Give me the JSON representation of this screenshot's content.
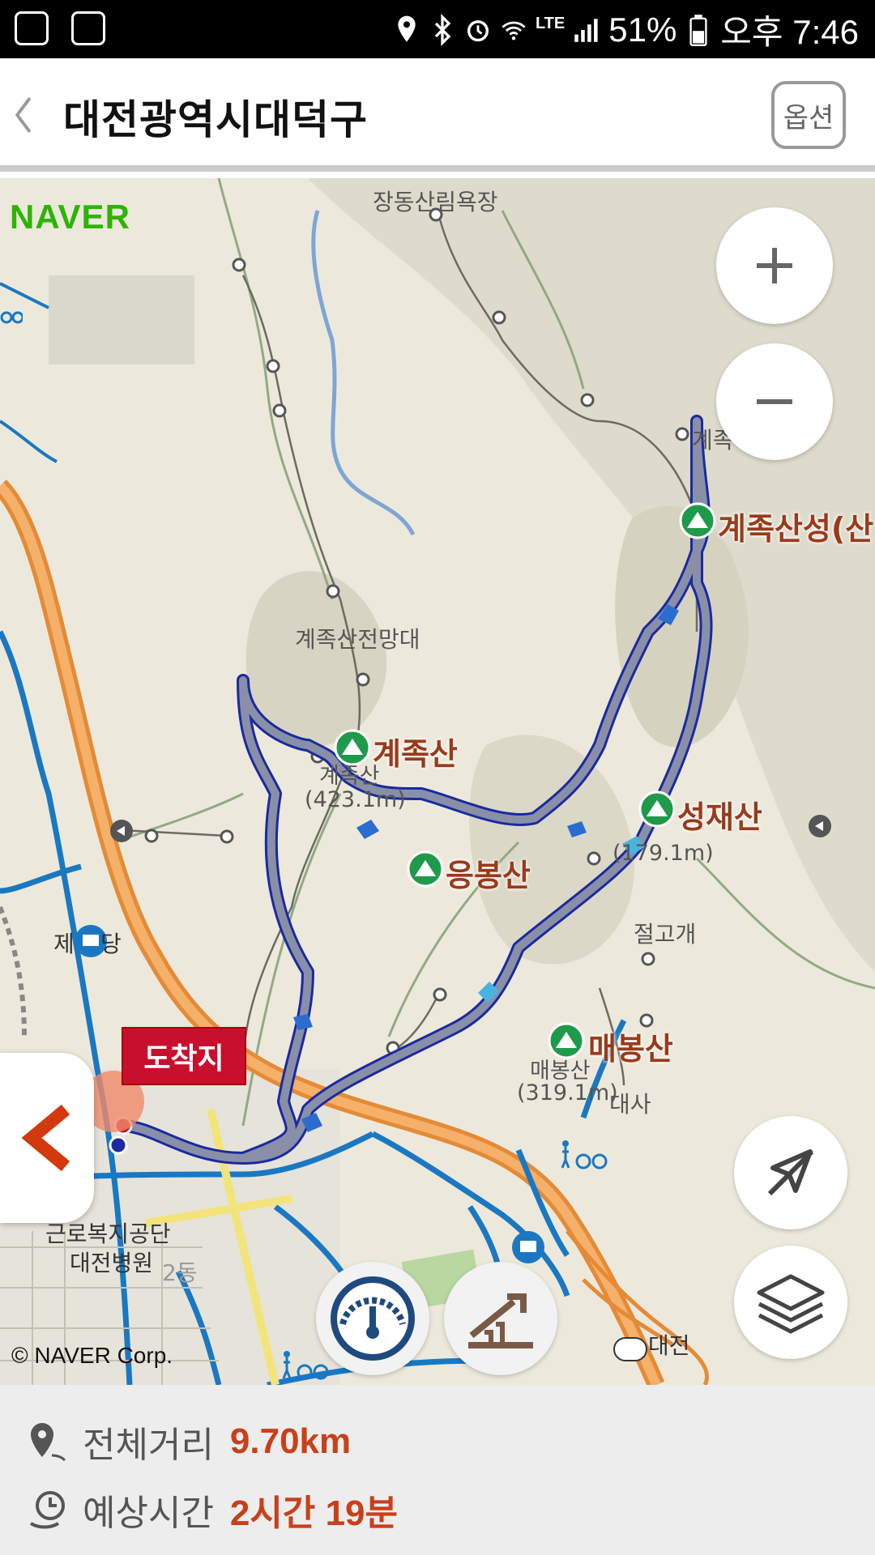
{
  "status_bar": {
    "battery": "51%",
    "time": "오후 7:46",
    "network": "LTE"
  },
  "header": {
    "title": "대전광역시대덕구",
    "option_label": "옵션"
  },
  "map": {
    "logo": "NAVER",
    "copyright": "© NAVER Corp.",
    "labels": {
      "forest_bath": "장동산림욕장",
      "observatory": "계족산전망대",
      "gye_small": "계족",
      "pass": "절고개",
      "temple": "대사",
      "daejeon_ic": "대전",
      "hospital_1": "근로복지공단",
      "hospital_2": "대전병원",
      "dong": "2동",
      "je": "제",
      "dang": "당"
    },
    "peaks": {
      "gyejok_fortress": "계족산성(산",
      "gyejok": "계족산",
      "gyejok_sub1": "계족산",
      "gyejok_sub2": "(423.1m)",
      "eungbong": "응봉산",
      "seongjae": "성재산",
      "seongjae_sub": "(179.1m)",
      "maebong": "매봉산",
      "maebong_sub1": "매봉산",
      "maebong_sub2": "(319.1m)"
    },
    "destination_tag": "도착지",
    "colors": {
      "route": "#8a8fa8",
      "route_edge": "#1a2aa0",
      "highway": "#f0a050",
      "road": "#1a78c2",
      "peak_marker": "#1f9a4a",
      "destination": "#c8102e"
    }
  },
  "info": {
    "distance_label": "전체거리",
    "distance_value": "9.70km",
    "time_label": "예상시간",
    "time_value": "2시간 19분"
  }
}
